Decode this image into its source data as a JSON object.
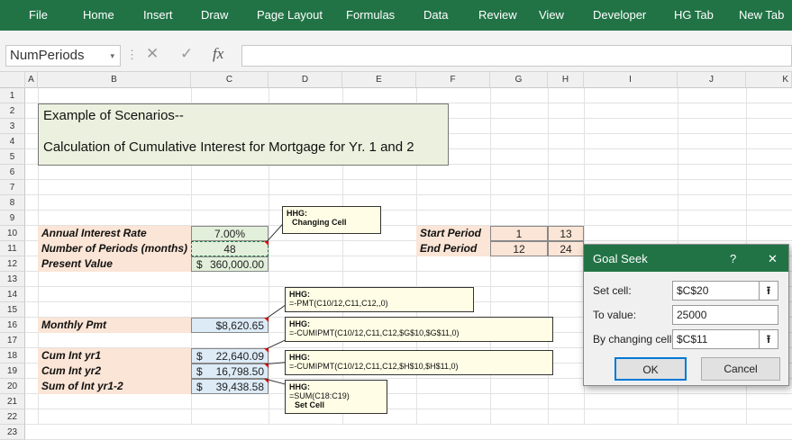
{
  "ribbon": {
    "tabs": [
      "File",
      "Home",
      "Insert",
      "Draw",
      "Page Layout",
      "Formulas",
      "Data",
      "Review",
      "View",
      "Developer",
      "HG Tab",
      "New Tab"
    ]
  },
  "formula_bar": {
    "name_box": "NumPeriods",
    "name_dropdown": "▾",
    "sep": "⋮",
    "cancel": "✕",
    "enter": "✓",
    "fx": "fx",
    "formula": ""
  },
  "columns": [
    "A",
    "B",
    "C",
    "D",
    "E",
    "F",
    "G",
    "H",
    "I",
    "J",
    "K"
  ],
  "rows": [
    "1",
    "2",
    "3",
    "4",
    "5",
    "6",
    "7",
    "8",
    "9",
    "10",
    "11",
    "12",
    "13",
    "14",
    "15",
    "16",
    "17",
    "18",
    "19",
    "20",
    "21",
    "22",
    "23"
  ],
  "title_box": {
    "line1": "Example of Scenarios--",
    "line2": "Calculation of Cumulative Interest for Mortgage for Yr. 1 and 2"
  },
  "inputs": {
    "rate_label": "Annual Interest Rate",
    "rate_value": "7.00%",
    "periods_label": "Number of Periods (months)",
    "periods_value": "48",
    "pv_label": "Present Value",
    "pv_currency": "$",
    "pv_value": "360,000.00"
  },
  "periods": {
    "start_label": "Start Period",
    "start_g": "1",
    "start_h": "13",
    "end_label": "End Period",
    "end_g": "12",
    "end_h": "24"
  },
  "outputs": {
    "pmt_label": "Monthly Pmt",
    "pmt_value": "$8,620.65",
    "yr1_label": "Cum Int yr1",
    "yr1_currency": "$",
    "yr1_value": "22,640.09",
    "yr2_label": "Cum Int yr2",
    "yr2_currency": "$",
    "yr2_value": "16,798.50",
    "sum_label": "Sum of Int yr1-2",
    "sum_currency": "$",
    "sum_value": "39,438.58"
  },
  "notes": {
    "changing_head": "HHG:",
    "changing_body": "Changing Cell",
    "pmt_head": "HHG:",
    "pmt_body": "=-PMT(C10/12,C11,C12,,0)",
    "yr1_head": "HHG:",
    "yr1_body": "=-CUMIPMT(C10/12,C11,C12,$G$10,$G$11,0)",
    "yr2_head": "HHG:",
    "yr2_body": "=-CUMIPMT(C10/12,C11,C12,$H$10,$H$11,0)",
    "sum_head": "HHG:",
    "sum_body": "=SUM(C18:C19)",
    "sum_set": "Set Cell"
  },
  "goal_seek": {
    "title": "Goal Seek",
    "help": "?",
    "close": "✕",
    "set_cell_label": "Set cell:",
    "set_cell_value": "$C$20",
    "to_value_label": "To value:",
    "to_value_value": "25000",
    "changing_label": "By changing cell:",
    "changing_value": "$C$11",
    "ref_icon": "⭱",
    "ok": "OK",
    "cancel": "Cancel"
  },
  "colors": {
    "ribbon": "#217346",
    "label_fill": "#fbe5d6",
    "input_fill": "#e2efda",
    "pmt_fill": "#ddebf7",
    "note_fill": "#fffde5"
  }
}
